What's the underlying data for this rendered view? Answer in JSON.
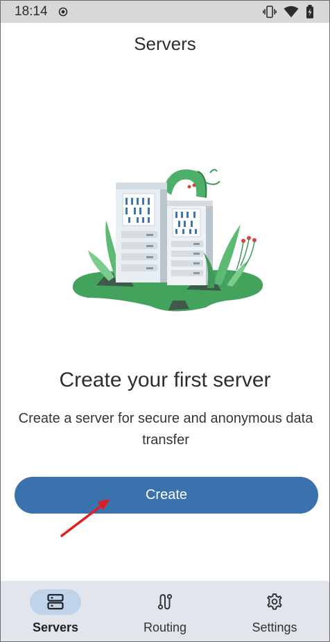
{
  "status_bar": {
    "time": "18:14"
  },
  "app_bar": {
    "title": "Servers"
  },
  "empty_state": {
    "headline": "Create your first server",
    "description": "Create a server for secure and anonymous data transfer",
    "illustration_icon": "servers-illustration"
  },
  "create_button": {
    "label": "Create"
  },
  "bottom_nav": {
    "items": [
      {
        "label": "Servers",
        "icon": "server-icon",
        "active": true
      },
      {
        "label": "Routing",
        "icon": "routing-icon",
        "active": false
      },
      {
        "label": "Settings",
        "icon": "gear-icon",
        "active": false
      }
    ]
  },
  "colors": {
    "primary": "#3972ad",
    "nav_background": "#e2e6ec",
    "nav_active_pill": "#bfd4ea",
    "status_bar": "#d8d8d8",
    "annotation_arrow": "#e11d1d"
  }
}
